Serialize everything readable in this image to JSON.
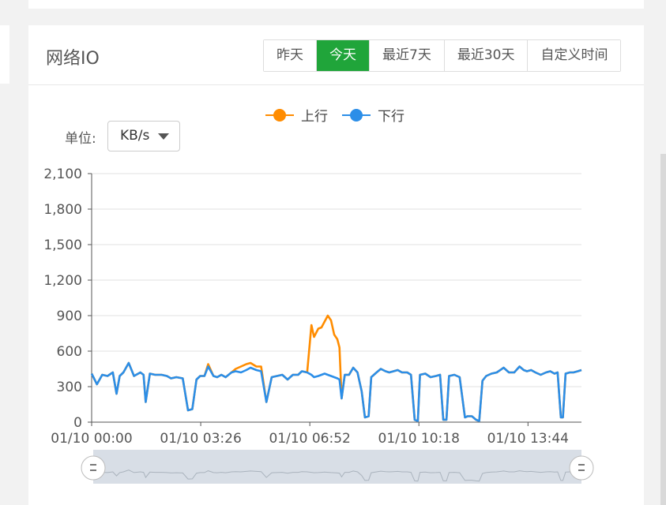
{
  "card": {
    "title": "网络IO",
    "range_buttons": [
      {
        "label": "昨天",
        "active": false
      },
      {
        "label": "今天",
        "active": true
      },
      {
        "label": "最近7天",
        "active": false
      },
      {
        "label": "最近30天",
        "active": false
      },
      {
        "label": "自定义时间",
        "active": false
      }
    ],
    "unit_label": "单位:",
    "unit_value": "KB/s"
  },
  "colors": {
    "accent": "#20a53a",
    "up": "#ff8c00",
    "down": "#2b8ee8",
    "grid": "#e0e0e0",
    "axis": "#555555",
    "zoom_bg": "#d8dee6"
  },
  "chart_data": {
    "type": "line",
    "title": "",
    "xlabel": "",
    "ylabel": "",
    "ylim": [
      0,
      2100
    ],
    "yticks": [
      "0",
      "300",
      "600",
      "900",
      "1,200",
      "1,500",
      "1,800",
      "2,100"
    ],
    "xticks": [
      "01/10 00:00",
      "01/10 03:26",
      "01/10 06:52",
      "01/10 10:18",
      "01/10 13:44"
    ],
    "x_range_minutes": [
      0,
      925
    ],
    "legend": {
      "position": "top-center"
    },
    "grid": true,
    "series": [
      {
        "name": "上行",
        "color": "#ff8c00",
        "points": [
          [
            0,
            410
          ],
          [
            10,
            320
          ],
          [
            20,
            400
          ],
          [
            30,
            390
          ],
          [
            40,
            420
          ],
          [
            47,
            240
          ],
          [
            53,
            390
          ],
          [
            60,
            420
          ],
          [
            70,
            500
          ],
          [
            80,
            390
          ],
          [
            92,
            420
          ],
          [
            98,
            400
          ],
          [
            102,
            170
          ],
          [
            110,
            410
          ],
          [
            120,
            400
          ],
          [
            132,
            400
          ],
          [
            142,
            390
          ],
          [
            150,
            370
          ],
          [
            160,
            380
          ],
          [
            172,
            370
          ],
          [
            182,
            100
          ],
          [
            190,
            110
          ],
          [
            198,
            360
          ],
          [
            205,
            390
          ],
          [
            213,
            390
          ],
          [
            220,
            490
          ],
          [
            230,
            390
          ],
          [
            237,
            380
          ],
          [
            245,
            400
          ],
          [
            253,
            380
          ],
          [
            264,
            420
          ],
          [
            272,
            450
          ],
          [
            282,
            470
          ],
          [
            292,
            490
          ],
          [
            300,
            500
          ],
          [
            311,
            470
          ],
          [
            320,
            470
          ],
          [
            330,
            170
          ],
          [
            340,
            380
          ],
          [
            350,
            390
          ],
          [
            360,
            400
          ],
          [
            370,
            360
          ],
          [
            380,
            400
          ],
          [
            390,
            400
          ],
          [
            397,
            430
          ],
          [
            407,
            420
          ],
          [
            415,
            820
          ],
          [
            420,
            720
          ],
          [
            428,
            790
          ],
          [
            434,
            800
          ],
          [
            440,
            850
          ],
          [
            446,
            900
          ],
          [
            452,
            860
          ],
          [
            458,
            740
          ],
          [
            464,
            700
          ],
          [
            468,
            630
          ],
          [
            472,
            200
          ],
          [
            478,
            400
          ],
          [
            486,
            400
          ],
          [
            494,
            460
          ],
          [
            502,
            420
          ],
          [
            510,
            260
          ],
          [
            516,
            40
          ],
          [
            523,
            50
          ],
          [
            528,
            380
          ],
          [
            538,
            420
          ],
          [
            546,
            450
          ],
          [
            555,
            430
          ],
          [
            562,
            420
          ],
          [
            570,
            430
          ],
          [
            578,
            440
          ],
          [
            586,
            420
          ],
          [
            596,
            420
          ],
          [
            603,
            400
          ],
          [
            610,
            20
          ],
          [
            616,
            10
          ],
          [
            620,
            400
          ],
          [
            630,
            410
          ],
          [
            640,
            380
          ],
          [
            650,
            390
          ],
          [
            658,
            400
          ],
          [
            664,
            20
          ],
          [
            670,
            20
          ],
          [
            675,
            390
          ],
          [
            685,
            400
          ],
          [
            695,
            380
          ],
          [
            705,
            40
          ],
          [
            710,
            50
          ],
          [
            718,
            50
          ],
          [
            726,
            20
          ],
          [
            732,
            10
          ],
          [
            738,
            350
          ],
          [
            745,
            390
          ],
          [
            755,
            410
          ],
          [
            765,
            420
          ],
          [
            778,
            460
          ],
          [
            788,
            420
          ],
          [
            798,
            420
          ],
          [
            808,
            470
          ],
          [
            816,
            440
          ],
          [
            822,
            430
          ],
          [
            830,
            440
          ],
          [
            838,
            420
          ],
          [
            848,
            400
          ],
          [
            858,
            420
          ],
          [
            866,
            430
          ],
          [
            874,
            410
          ],
          [
            880,
            420
          ],
          [
            886,
            40
          ],
          [
            890,
            40
          ],
          [
            895,
            410
          ],
          [
            903,
            420
          ],
          [
            910,
            420
          ],
          [
            918,
            430
          ],
          [
            925,
            440
          ]
        ]
      },
      {
        "name": "下行",
        "color": "#2b8ee8",
        "points": [
          [
            0,
            410
          ],
          [
            10,
            320
          ],
          [
            20,
            400
          ],
          [
            30,
            390
          ],
          [
            40,
            420
          ],
          [
            47,
            240
          ],
          [
            53,
            390
          ],
          [
            60,
            420
          ],
          [
            70,
            500
          ],
          [
            80,
            390
          ],
          [
            92,
            420
          ],
          [
            98,
            400
          ],
          [
            102,
            170
          ],
          [
            110,
            410
          ],
          [
            120,
            400
          ],
          [
            132,
            400
          ],
          [
            142,
            390
          ],
          [
            150,
            370
          ],
          [
            160,
            380
          ],
          [
            172,
            370
          ],
          [
            182,
            100
          ],
          [
            190,
            110
          ],
          [
            198,
            360
          ],
          [
            205,
            390
          ],
          [
            213,
            390
          ],
          [
            220,
            470
          ],
          [
            230,
            390
          ],
          [
            237,
            380
          ],
          [
            245,
            400
          ],
          [
            253,
            380
          ],
          [
            264,
            420
          ],
          [
            272,
            430
          ],
          [
            282,
            420
          ],
          [
            292,
            440
          ],
          [
            300,
            460
          ],
          [
            311,
            440
          ],
          [
            320,
            430
          ],
          [
            330,
            170
          ],
          [
            340,
            380
          ],
          [
            350,
            390
          ],
          [
            360,
            400
          ],
          [
            370,
            360
          ],
          [
            380,
            400
          ],
          [
            390,
            400
          ],
          [
            397,
            430
          ],
          [
            407,
            420
          ],
          [
            415,
            400
          ],
          [
            420,
            380
          ],
          [
            428,
            390
          ],
          [
            434,
            400
          ],
          [
            440,
            410
          ],
          [
            446,
            400
          ],
          [
            452,
            390
          ],
          [
            458,
            380
          ],
          [
            464,
            370
          ],
          [
            468,
            360
          ],
          [
            472,
            200
          ],
          [
            478,
            400
          ],
          [
            486,
            400
          ],
          [
            494,
            460
          ],
          [
            502,
            420
          ],
          [
            510,
            260
          ],
          [
            516,
            40
          ],
          [
            523,
            50
          ],
          [
            528,
            380
          ],
          [
            538,
            420
          ],
          [
            546,
            450
          ],
          [
            555,
            430
          ],
          [
            562,
            420
          ],
          [
            570,
            430
          ],
          [
            578,
            440
          ],
          [
            586,
            420
          ],
          [
            596,
            420
          ],
          [
            603,
            400
          ],
          [
            610,
            20
          ],
          [
            616,
            10
          ],
          [
            620,
            400
          ],
          [
            630,
            410
          ],
          [
            640,
            380
          ],
          [
            650,
            390
          ],
          [
            658,
            400
          ],
          [
            664,
            20
          ],
          [
            670,
            20
          ],
          [
            675,
            390
          ],
          [
            685,
            400
          ],
          [
            695,
            380
          ],
          [
            705,
            40
          ],
          [
            710,
            50
          ],
          [
            718,
            50
          ],
          [
            726,
            20
          ],
          [
            732,
            10
          ],
          [
            738,
            350
          ],
          [
            745,
            390
          ],
          [
            755,
            410
          ],
          [
            765,
            420
          ],
          [
            778,
            460
          ],
          [
            788,
            420
          ],
          [
            798,
            420
          ],
          [
            808,
            470
          ],
          [
            816,
            440
          ],
          [
            822,
            430
          ],
          [
            830,
            440
          ],
          [
            838,
            420
          ],
          [
            848,
            400
          ],
          [
            858,
            420
          ],
          [
            866,
            430
          ],
          [
            874,
            410
          ],
          [
            880,
            420
          ],
          [
            886,
            40
          ],
          [
            890,
            40
          ],
          [
            895,
            410
          ],
          [
            903,
            420
          ],
          [
            910,
            420
          ],
          [
            918,
            430
          ],
          [
            925,
            440
          ]
        ]
      }
    ]
  }
}
